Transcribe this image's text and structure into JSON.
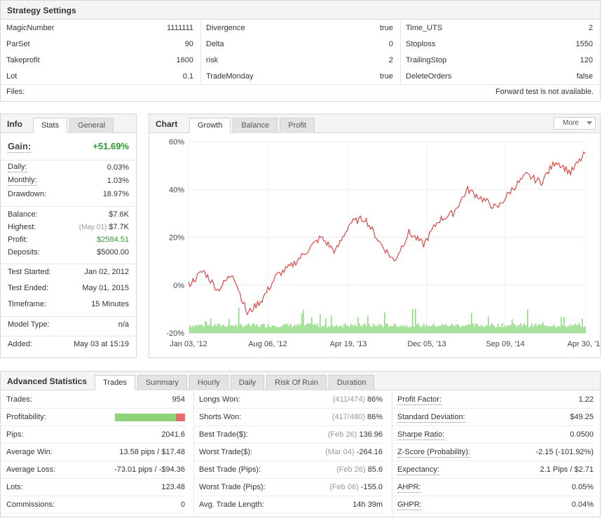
{
  "settings": {
    "title": "Strategy Settings",
    "cols": [
      [
        [
          "MagicNumber",
          "1111111"
        ],
        [
          "ParSet",
          "90"
        ],
        [
          "Takeprofit",
          "1600"
        ],
        [
          "Lot",
          "0.1"
        ]
      ],
      [
        [
          "Divergence",
          "true"
        ],
        [
          "Delta",
          "0"
        ],
        [
          "risk",
          "2"
        ],
        [
          "TradeMonday",
          "true"
        ]
      ],
      [
        [
          "Time_UTS",
          "2"
        ],
        [
          "Stoploss",
          "1550"
        ],
        [
          "TrailingStop",
          "120"
        ],
        [
          "DeleteOrders",
          "false"
        ]
      ]
    ],
    "files_label": "Files:",
    "forward_note": "Forward test is not available."
  },
  "info": {
    "title": "Info",
    "tabs": [
      "Stats",
      "General"
    ],
    "gain_label": "Gain:",
    "gain_value": "+51.69%",
    "daily_label": "Daily:",
    "daily": "0.03%",
    "monthly_label": "Monthly:",
    "monthly": "1.03%",
    "drawdown_label": "Drawdown:",
    "drawdown": "18.97%",
    "balance_label": "Balance:",
    "balance": "$7.6K",
    "highest_label": "Highest:",
    "highest_date": "(May 01)",
    "highest": "$7.7K",
    "profit_label": "Profit:",
    "profit": "$2584.51",
    "deposits_label": "Deposits:",
    "deposits": "$5000.00",
    "test_started_label": "Test Started:",
    "test_started": "Jan 02, 2012",
    "test_ended_label": "Test Ended:",
    "test_ended": "May 01, 2015",
    "timeframe_label": "Timeframe:",
    "timeframe": "15 Minutes",
    "model_label": "Model Type:",
    "model": "n/a",
    "added_label": "Added:",
    "added": "May 03 at 15:19"
  },
  "chart": {
    "title": "Chart",
    "tabs": [
      "Growth",
      "Balance",
      "Profit"
    ],
    "more": "More"
  },
  "chart_data": {
    "type": "line",
    "series": [
      {
        "values": [
          0,
          6,
          -2,
          5,
          -12,
          -6,
          4,
          8,
          14,
          20,
          14,
          26,
          28,
          18,
          10,
          22,
          17,
          27,
          30,
          40,
          36,
          32,
          40,
          46,
          43,
          52,
          47,
          55
        ]
      }
    ],
    "x_ticks": [
      "Jan 03, '12",
      "Aug 06, '12",
      "Apr 19, '13",
      "Dec 05, '13",
      "Sep 09, '14",
      "Apr 30, '15"
    ],
    "y_ticks": [
      "60%",
      "40%",
      "20%",
      "0%",
      "-20%"
    ],
    "ylim": [
      -20,
      60
    ]
  },
  "adv": {
    "title": "Advanced Statistics",
    "tabs": [
      "Trades",
      "Summary",
      "Hourly",
      "Daily",
      "Risk Of Ruin",
      "Duration"
    ],
    "c1": [
      [
        "Trades:",
        "",
        "954"
      ],
      [
        "Profitability:",
        "",
        ""
      ],
      [
        "Pips:",
        "",
        "2041.6"
      ],
      [
        "Average Win:",
        "",
        "13.58 pips / $17.48"
      ],
      [
        "Average Loss:",
        "",
        "-73.01 pips / -$94.36"
      ],
      [
        "Lots:",
        "",
        "123.48"
      ],
      [
        "Commissions:",
        "",
        "0"
      ]
    ],
    "c2": [
      [
        "Longs Won:",
        "(411/474)",
        "86%"
      ],
      [
        "Shorts Won:",
        "(417/480)",
        "86%"
      ],
      [
        "Best Trade($):",
        "(Feb 26)",
        "136.96"
      ],
      [
        "Worst Trade($):",
        "(Mar 04)",
        "-264.16"
      ],
      [
        "Best Trade (Pips):",
        "(Feb 26)",
        "85.6"
      ],
      [
        "Worst Trade (Pips):",
        "(Feb 06)",
        "-155.0"
      ],
      [
        "Avg. Trade Length:",
        "",
        "14h 39m"
      ]
    ],
    "c3": [
      [
        "Profit Factor:",
        "",
        "1.22"
      ],
      [
        "Standard Deviation:",
        "",
        "$49.25"
      ],
      [
        "Sharpe Ratio:",
        "",
        "0.0500"
      ],
      [
        "Z-Score (Probability):",
        "",
        "-2.15 (-101.92%)"
      ],
      [
        "Expectancy:",
        "",
        "2.1 Pips / $2.71"
      ],
      [
        "AHPR:",
        "",
        "0.05%"
      ],
      [
        "GHPR:",
        "",
        "0.04%"
      ]
    ],
    "profitability_pct": 87
  }
}
